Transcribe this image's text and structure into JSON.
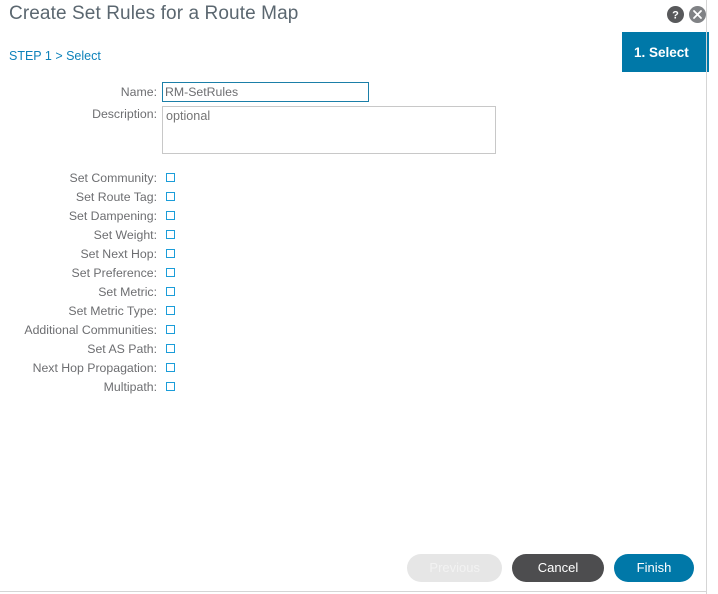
{
  "header": {
    "title": "Create Set Rules for a Route Map",
    "help_icon": "help-icon",
    "close_icon": "close-icon"
  },
  "breadcrumb": {
    "text": "STEP 1 > Select"
  },
  "step_tab": {
    "label": "1. Select"
  },
  "form": {
    "name": {
      "label": "Name:",
      "value": "RM-SetRules",
      "placeholder": ""
    },
    "description": {
      "label": "Description:",
      "value": "",
      "placeholder": "optional"
    },
    "checkboxes": [
      {
        "label": "Set Community:",
        "checked": false
      },
      {
        "label": "Set Route Tag:",
        "checked": false
      },
      {
        "label": "Set Dampening:",
        "checked": false
      },
      {
        "label": "Set Weight:",
        "checked": false
      },
      {
        "label": "Set Next Hop:",
        "checked": false
      },
      {
        "label": "Set Preference:",
        "checked": false
      },
      {
        "label": "Set Metric:",
        "checked": false
      },
      {
        "label": "Set Metric Type:",
        "checked": false
      },
      {
        "label": "Additional Communities:",
        "checked": false
      },
      {
        "label": "Set AS Path:",
        "checked": false
      },
      {
        "label": "Next Hop Propagation:",
        "checked": false
      },
      {
        "label": "Multipath:",
        "checked": false
      }
    ]
  },
  "footer": {
    "previous_label": "Previous",
    "cancel_label": "Cancel",
    "finish_label": "Finish"
  },
  "colors": {
    "accent": "#0078a8",
    "link": "#0d82ba",
    "checkbox_border": "#1b9dd9",
    "input_focus_border": "#1b7fa8",
    "cancel_bg": "#4d4d4f",
    "title_text": "#5b6770",
    "label_text": "#6d6e71"
  }
}
